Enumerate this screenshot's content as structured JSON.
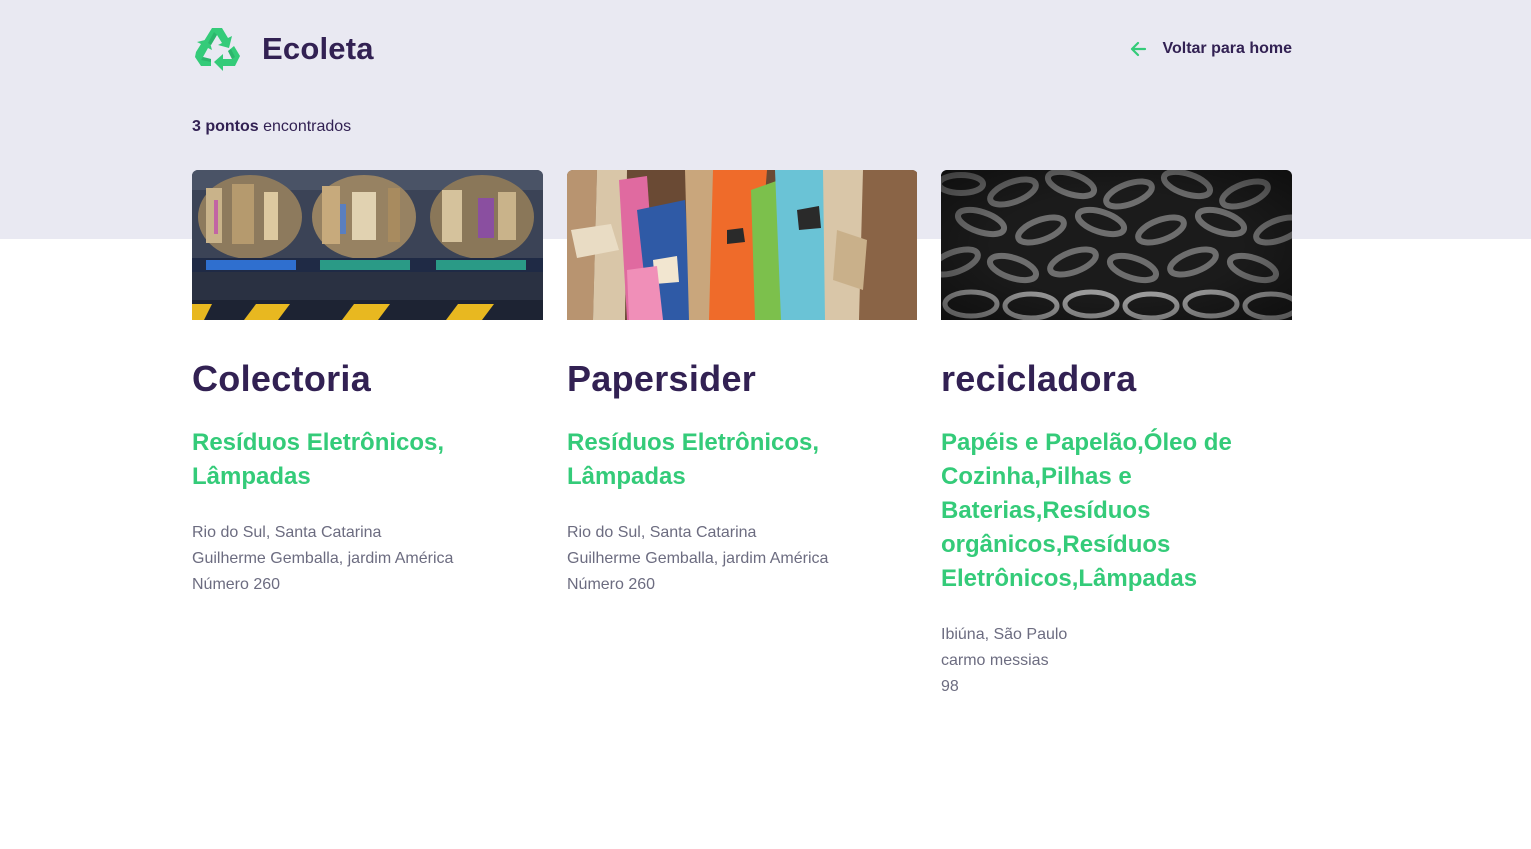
{
  "header": {
    "logo_icon": "recycle-icon",
    "app_name": "Ecoleta",
    "back_link": "Voltar para home",
    "back_icon": "arrow-left-icon"
  },
  "results": {
    "count_bold": "3 pontos",
    "count_rest": " encontrados"
  },
  "colors": {
    "accent": "#34cb79",
    "title": "#322153",
    "text": "#6c6c80",
    "header_bg": "#e9e9f2"
  },
  "points": [
    {
      "name": "Colectoria",
      "items": "Resíduos Eletrônicos, Lâmpadas",
      "city_state": "Rio do Sul, Santa Catarina",
      "street": "Guilherme Gemballa, jardim América",
      "number": "Número 260"
    },
    {
      "name": "Papersider",
      "items": "Resíduos Eletrônicos, Lâmpadas",
      "city_state": "Rio do Sul, Santa Catarina",
      "street": "Guilherme Gemballa, jardim América",
      "number": "Número 260"
    },
    {
      "name": "recicladora",
      "items": "Papéis e Papelão,Óleo de Cozinha,Pilhas e Baterias,Resíduos orgânicos,Resíduos Eletrônicos,Lâmpadas",
      "city_state": "Ibiúna, São Paulo",
      "street": "carmo messias",
      "number": "98"
    }
  ]
}
